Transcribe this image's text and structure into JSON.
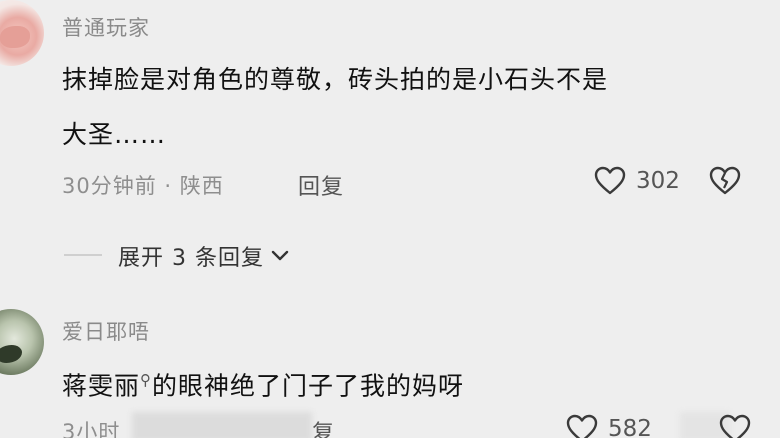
{
  "comments": [
    {
      "username": "普通玩家",
      "content_line1": "抹掉脸是对角色的尊敬，砖头拍的是小石头不是",
      "content_line2": "大圣……",
      "time": "30分钟前",
      "location": "陕西",
      "meta_sep": "·",
      "reply_label": "回复",
      "likes": "302",
      "expand_label": "展开 3 条回复"
    },
    {
      "username": "爱日耶唔",
      "content_prefix": "蒋雯丽",
      "content_suffix": "的眼神绝了门子了我的妈呀",
      "time_partial": "3小时",
      "reply_partial": "复",
      "likes_partial": "582"
    }
  ],
  "icons": {
    "heart": "heart-icon",
    "dislike": "broken-heart-icon",
    "chevron": "chevron-down-icon",
    "search": "search-icon"
  }
}
